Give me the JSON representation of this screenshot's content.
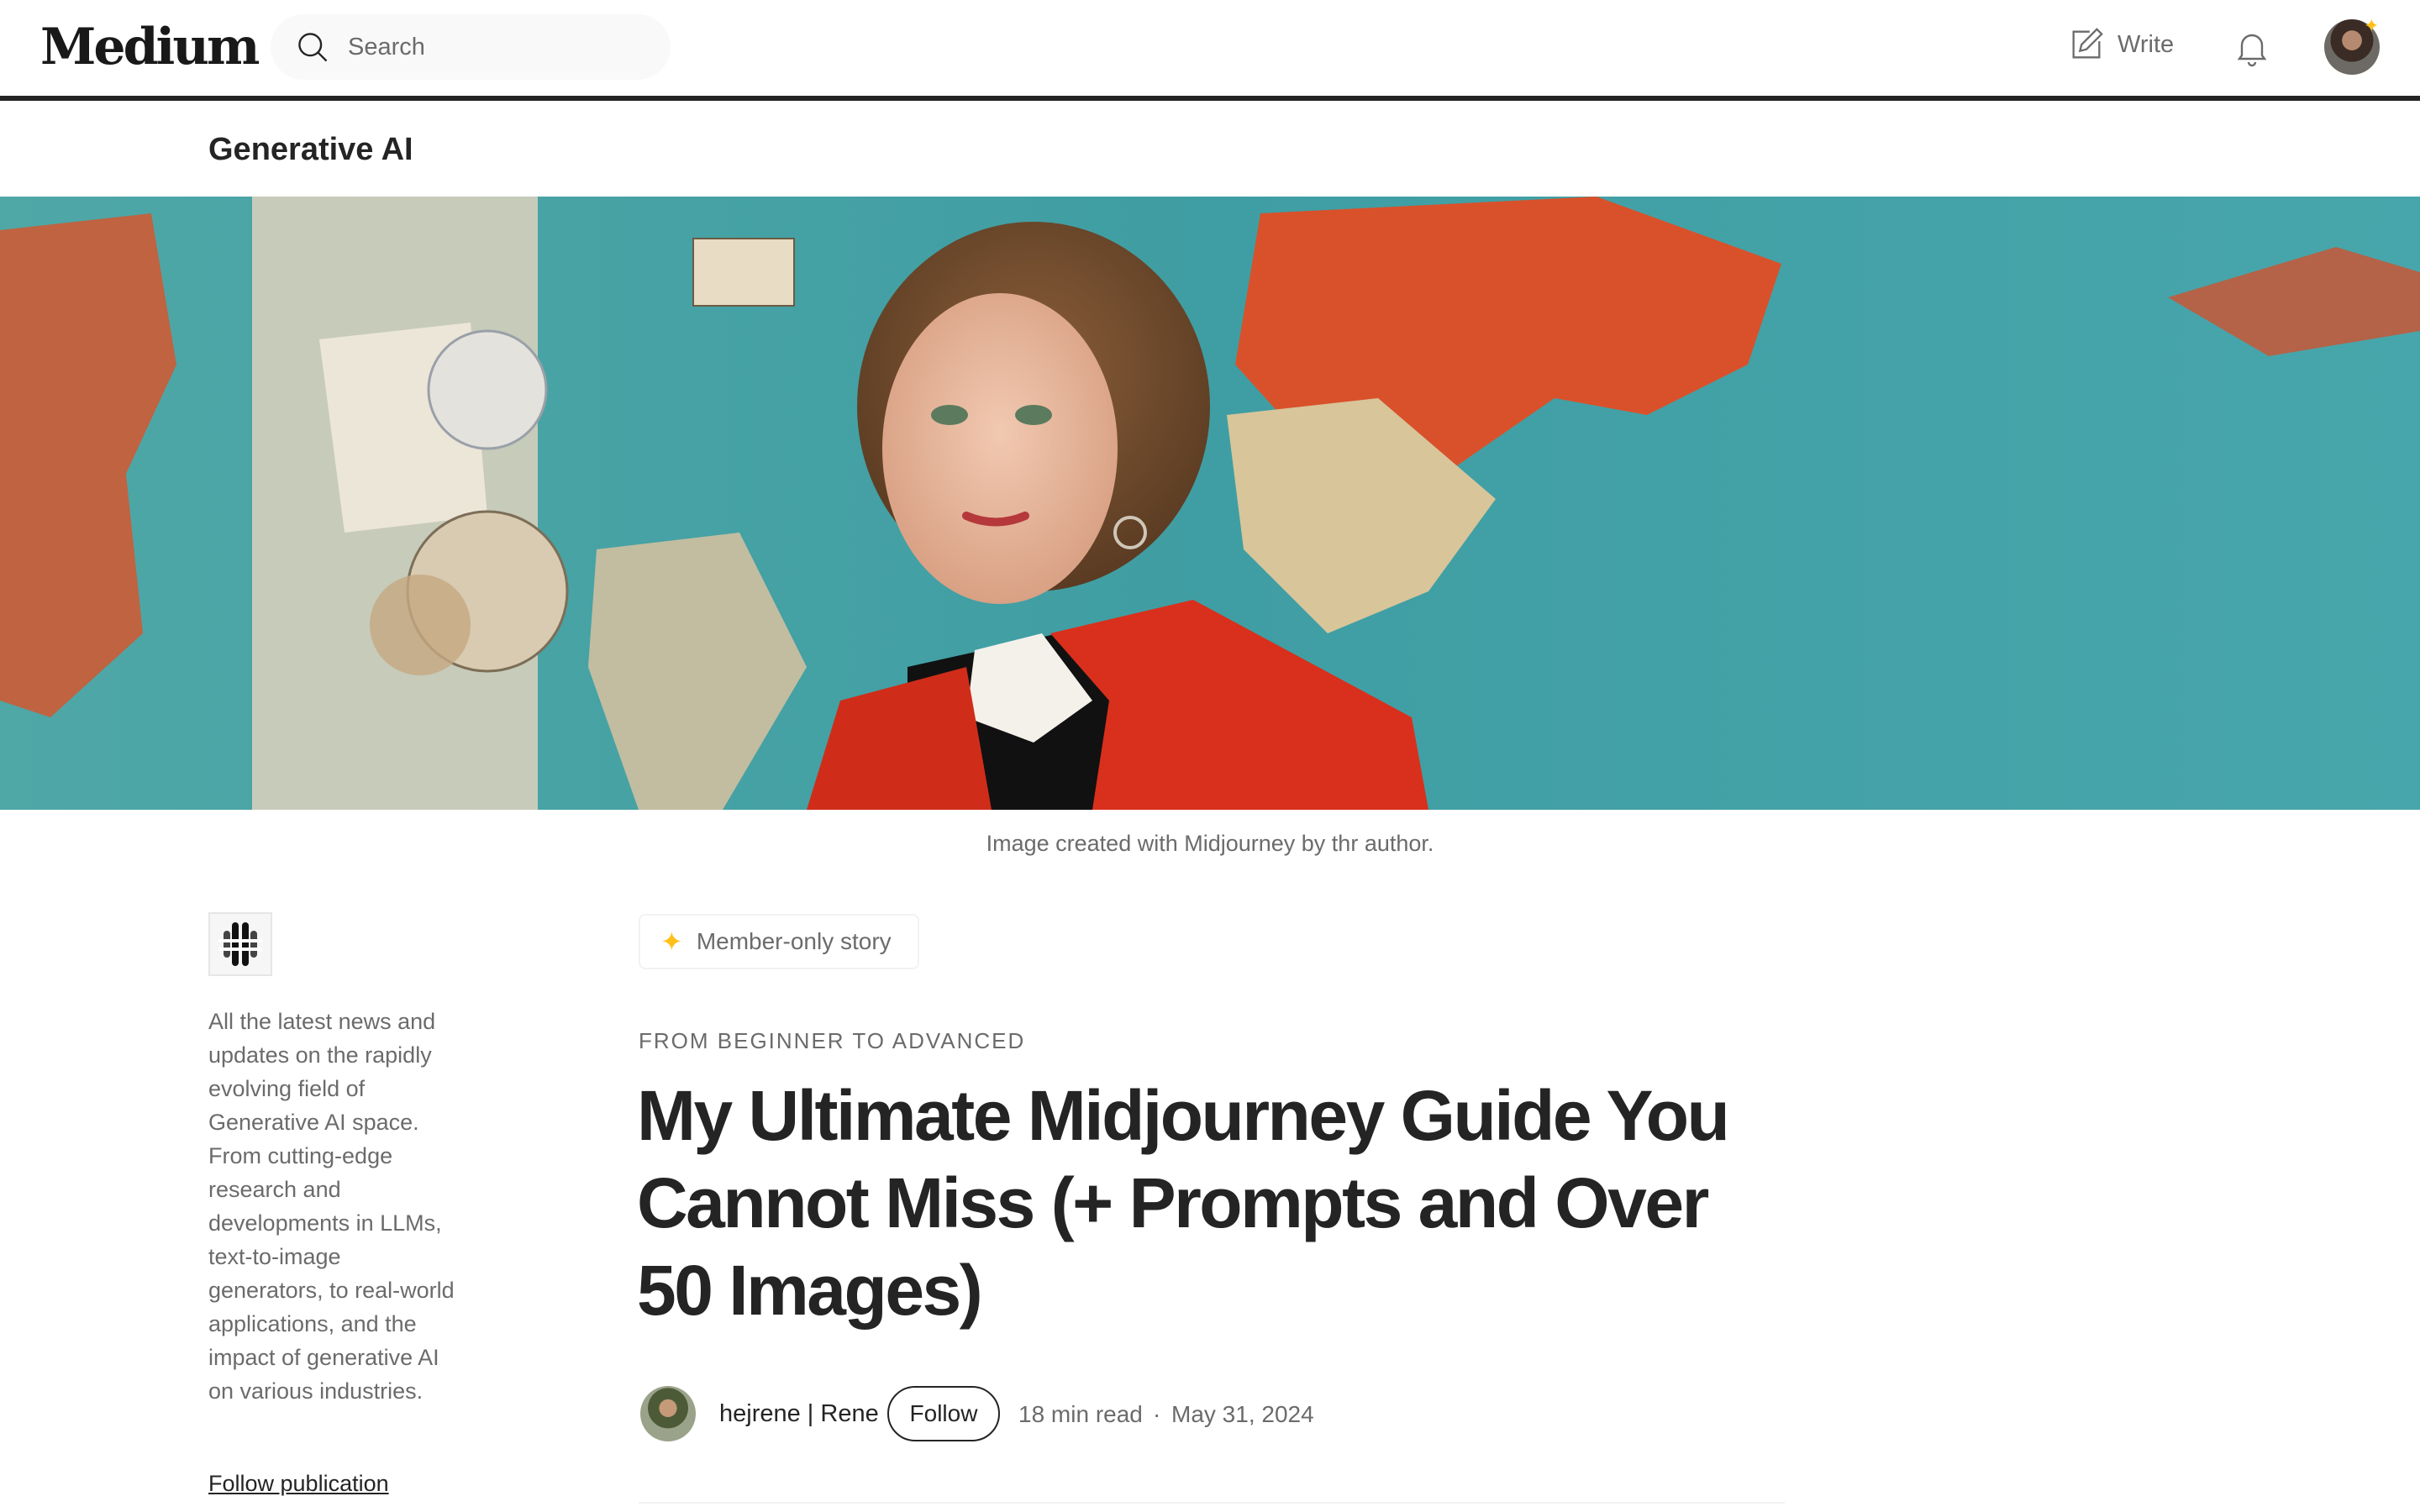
{
  "nav": {
    "logo": "Medium",
    "search_placeholder": "Search",
    "write_label": "Write"
  },
  "publication": {
    "name": "Generative AI",
    "description": "All the latest news and updates on the rapidly evolving field of Generative AI space. From cutting-edge research and developments in LLMs, text-to-image generators, to real-world applications, and the impact of generative AI on various industries.",
    "follow_label": "Follow publication"
  },
  "hero": {
    "caption": "Image created with Midjourney by thr author."
  },
  "article": {
    "member_label": "Member-only story",
    "kicker": "FROM BEGINNER TO ADVANCED",
    "title": "My Ultimate Midjourney Guide You Cannot Miss (+ Prompts and Over 50 Images)",
    "author": "hejrene | Rene",
    "follow_label": "Follow",
    "read_time": "18 min read",
    "separator": "·",
    "date": "May 31, 2024"
  },
  "colors": {
    "text": "#242424",
    "muted": "#6b6b6b",
    "member_star": "#ffc017"
  },
  "icons": [
    "search-icon",
    "write-icon",
    "bell-icon",
    "star-icon"
  ]
}
